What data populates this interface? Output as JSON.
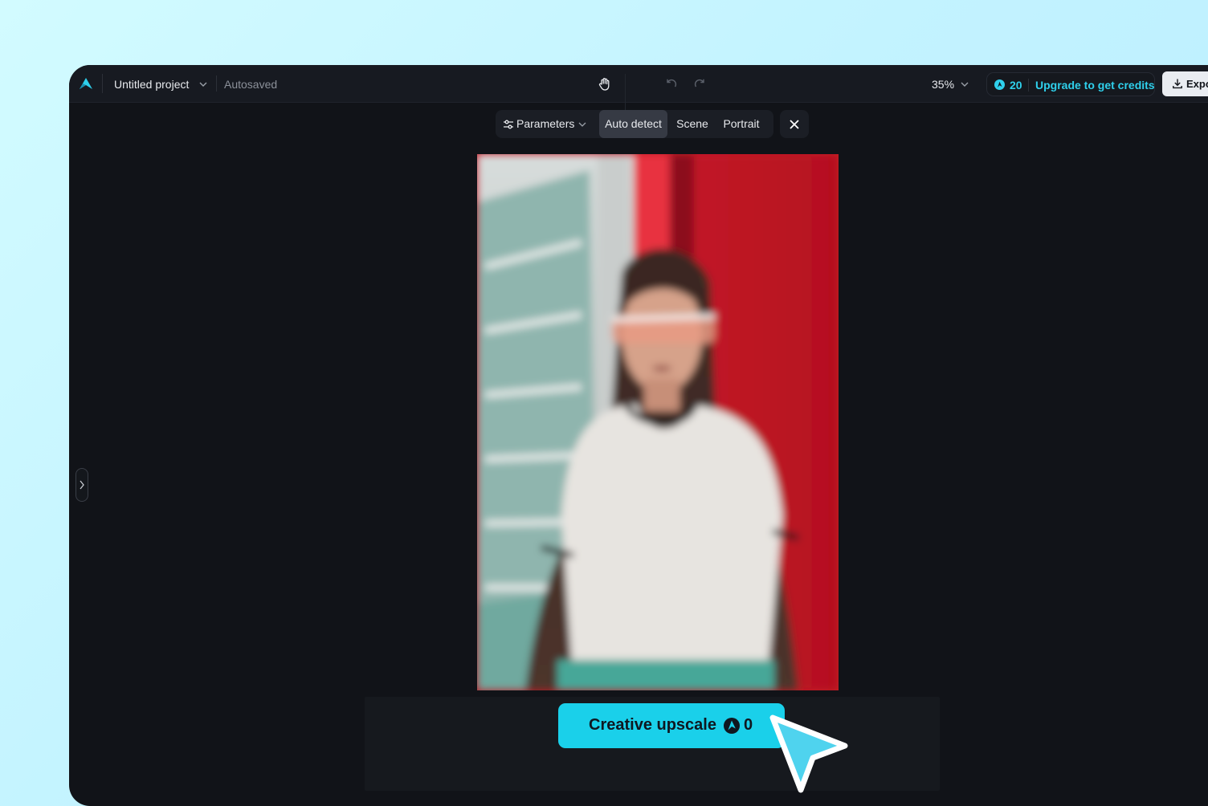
{
  "header": {
    "project_title": "Untitled project",
    "save_status": "Autosaved",
    "zoom_level": "35%",
    "credits": {
      "count": "20",
      "upgrade_label": "Upgrade to get credits"
    },
    "export_label": "Expo"
  },
  "parameters_bar": {
    "params_label": "Parameters",
    "segments": [
      "Auto detect",
      "Scene",
      "Portrait"
    ],
    "selected": "Auto detect"
  },
  "action": {
    "upscale_label": "Creative upscale",
    "upscale_cost": "0"
  },
  "colors": {
    "accent": "#1ad0ea",
    "credit_text": "#2fd0ec",
    "app_bg": "#111318",
    "topbar_bg": "#171a21"
  },
  "icons": [
    "logo-icon",
    "chevron-down-icon",
    "hand-icon",
    "undo-icon",
    "redo-icon",
    "credit-icon",
    "download-icon",
    "sliders-icon",
    "close-icon",
    "chevron-right-icon",
    "pointer-cursor-icon"
  ]
}
